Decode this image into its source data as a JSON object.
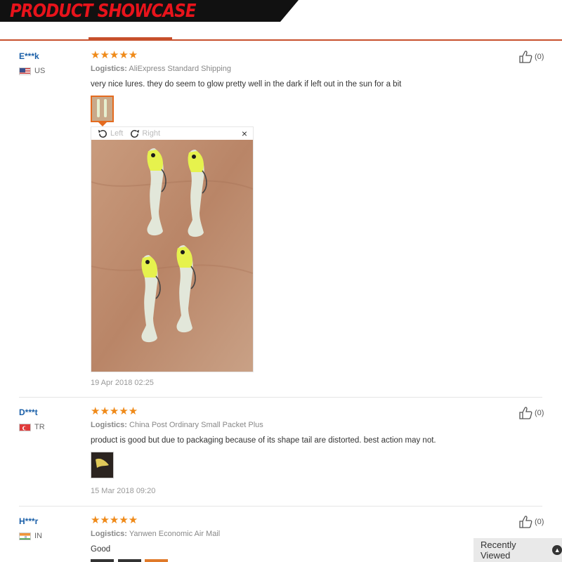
{
  "banner": {
    "title": "PRODUCT SHOWCASE"
  },
  "reviews": [
    {
      "user": "E***k",
      "country": "US",
      "stars": "★★★★★",
      "logistics_label": "Logistics:",
      "logistics_value": "AliExpress Standard Shipping",
      "text": "very nice lures. they do seem to glow pretty well in the dark if left out in the sun for a bit",
      "date": "19 Apr 2018 02:25",
      "helpful": "(0)"
    },
    {
      "user": "D***t",
      "country": "TR",
      "stars": "★★★★★",
      "logistics_label": "Logistics:",
      "logistics_value": "China Post Ordinary Small Packet Plus",
      "text": "product is good but due to packaging because of its shape tail are distorted. best action may not.",
      "date": "15 Mar 2018 09:20",
      "helpful": "(0)"
    },
    {
      "user": "H***r",
      "country": "IN",
      "stars": "★★★★★",
      "logistics_label": "Logistics:",
      "logistics_value": "Yanwen Economic Air Mail",
      "text": "Good",
      "helpful": "(0)"
    }
  ],
  "viewer": {
    "rotate_left": "Left",
    "rotate_right": "Right",
    "close": "×"
  },
  "recently_viewed": "Recently Viewed",
  "icons": {
    "thumbs_up": "thumbs-up-icon",
    "rotate_left": "rotate-left-icon",
    "rotate_right": "rotate-right-icon",
    "close": "close-icon",
    "chevron_up": "chevron-up-icon"
  },
  "colors": {
    "accent": "#c7502c",
    "star": "#ef8a19",
    "username": "#1a5fa8",
    "banner_text": "#e8131b"
  }
}
